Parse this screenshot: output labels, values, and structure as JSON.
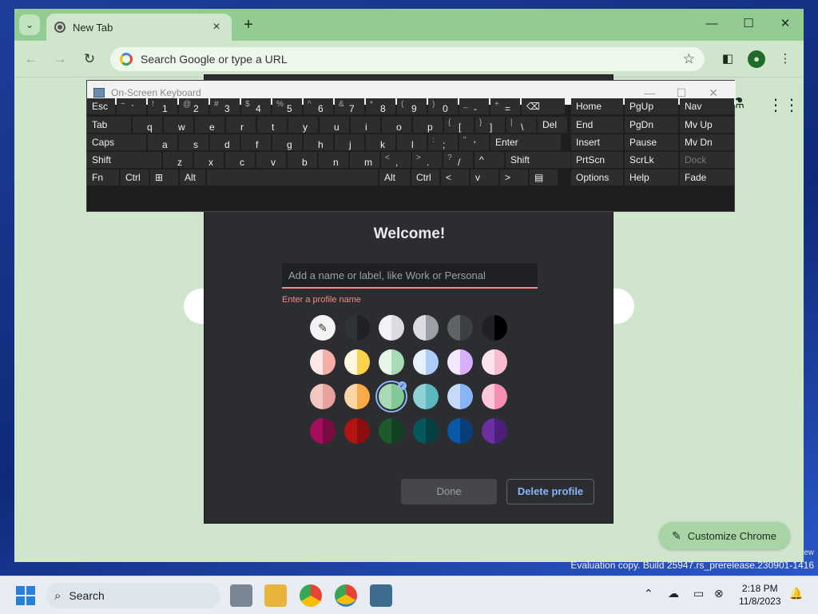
{
  "browser": {
    "tab_title": "New Tab",
    "new_tab_symbol": "+",
    "omnibox_placeholder": "Search Google or type a URL",
    "customize_label": "Customize Chrome"
  },
  "dialog": {
    "heading": "Welcome!",
    "name_placeholder": "Add a name or label, like Work or Personal",
    "error_text": "Enter a profile name",
    "done_label": "Done",
    "delete_label": "Delete profile",
    "colors": [
      [
        "picker",
        "#2f3236/#202124",
        "#f1f3f4/#dadce0",
        "#dadce0/#9aa0a6",
        "#5f6368/#3c4043",
        "#202124/#000000"
      ],
      [
        "#fce8e6/#f6aea9",
        "#fef7e0/#fcd34d",
        "#e6f4ea/#a8dab5",
        "#e8f0fe/#aecbfa",
        "#f3e8fd/#d7aefb",
        "#fce4ec/#f8bbd0"
      ],
      [
        "#f4c7c3/#e6a29c",
        "#fcd6a5/#f9ab48",
        "#a8dab5/#81c995",
        "#8ed1d4/#5bb8bd",
        "#c6dafc/#8ab4f8",
        "#fbcad8/#f48fb1"
      ],
      [
        "#a50e5a/#7a0a42",
        "#b31412/#8a0f0e",
        "#1e5b2c/#134020",
        "#06575c/#043f43",
        "#0b57a8/#083f7a",
        "#6b2fa3/#4e1f7a"
      ]
    ],
    "selected": "2-2"
  },
  "keyboard": {
    "title": "On-Screen Keyboard",
    "rows": [
      [
        [
          "Esc",
          ""
        ],
        [
          "~",
          "`"
        ],
        [
          "!",
          "1"
        ],
        [
          "@",
          "2"
        ],
        [
          "#",
          "3"
        ],
        [
          "$",
          "4"
        ],
        [
          "%",
          "5"
        ],
        [
          "^",
          "6"
        ],
        [
          "&",
          "7"
        ],
        [
          "*",
          "8"
        ],
        [
          "(",
          "9"
        ],
        [
          ")",
          "0"
        ],
        [
          "_",
          "-"
        ],
        [
          "+",
          "="
        ],
        [
          "⌫",
          ""
        ]
      ],
      [
        [
          "Tab",
          ""
        ],
        [
          "",
          "q"
        ],
        [
          "",
          "w"
        ],
        [
          "",
          "e"
        ],
        [
          "",
          "r"
        ],
        [
          "",
          "t"
        ],
        [
          "",
          "y"
        ],
        [
          "",
          "u"
        ],
        [
          "",
          "i"
        ],
        [
          "",
          "o"
        ],
        [
          "",
          "p"
        ],
        [
          "{",
          "["
        ],
        [
          "}",
          "]"
        ],
        [
          "|",
          "\\"
        ],
        [
          "Del",
          ""
        ]
      ],
      [
        [
          "Caps",
          ""
        ],
        [
          "",
          "a"
        ],
        [
          "",
          "s"
        ],
        [
          "",
          "d"
        ],
        [
          "",
          "f"
        ],
        [
          "",
          "g"
        ],
        [
          "",
          "h"
        ],
        [
          "",
          "j"
        ],
        [
          "",
          "k"
        ],
        [
          "",
          "l"
        ],
        [
          ":",
          ";"
        ],
        [
          "\"",
          "'"
        ],
        [
          "Enter",
          ""
        ]
      ],
      [
        [
          "Shift",
          ""
        ],
        [
          "",
          "z"
        ],
        [
          "",
          "x"
        ],
        [
          "",
          "c"
        ],
        [
          "",
          "v"
        ],
        [
          "",
          "b"
        ],
        [
          "",
          "n"
        ],
        [
          "",
          "m"
        ],
        [
          "<",
          ","
        ],
        [
          ">",
          "."
        ],
        [
          "?",
          "/"
        ],
        [
          "^",
          ""
        ],
        [
          "Shift",
          ""
        ]
      ],
      [
        [
          "Fn",
          ""
        ],
        [
          "Ctrl",
          ""
        ],
        [
          "⊞",
          ""
        ],
        [
          "Alt",
          ""
        ],
        [
          "",
          ""
        ],
        [
          "Alt",
          ""
        ],
        [
          "Ctrl",
          ""
        ],
        [
          "<",
          ""
        ],
        [
          "v",
          ""
        ],
        [
          ">",
          ""
        ],
        [
          "▤",
          ""
        ]
      ]
    ],
    "nav": [
      [
        "Home",
        "PgUp",
        "Nav"
      ],
      [
        "End",
        "PgDn",
        "Mv Up"
      ],
      [
        "Insert",
        "Pause",
        "Mv Dn"
      ],
      [
        "PrtScn",
        "ScrLk",
        "Dock"
      ],
      [
        "Options",
        "Help",
        "Fade"
      ]
    ]
  },
  "desktop": {
    "eval_text": "Evaluation copy. Build 25947.rs_prerelease.230901-1416",
    "eval_partial": "ew"
  },
  "taskbar": {
    "search_label": "Search",
    "time": "2:18 PM",
    "date": "11/8/2023"
  }
}
